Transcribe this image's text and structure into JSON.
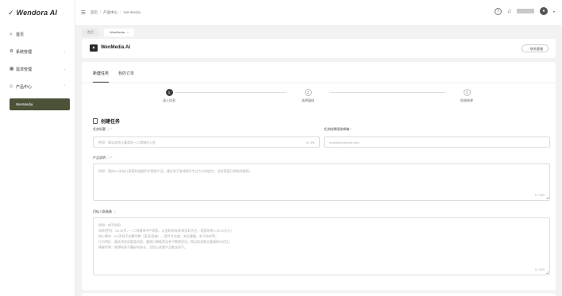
{
  "brand": {
    "name": "Wendora AI"
  },
  "sidebar": {
    "items": [
      {
        "label": "首页",
        "icon": "home-icon"
      },
      {
        "label": "系统管理",
        "icon": "gear-icon"
      },
      {
        "label": "需求管理",
        "icon": "grid-icon"
      },
      {
        "label": "产品中心",
        "icon": "tag-icon"
      }
    ],
    "active_sub": "WenMedia"
  },
  "header": {
    "breadcrumb": [
      "首页",
      "产品中心",
      "WenMedia"
    ]
  },
  "tabs": [
    {
      "label": "首页"
    },
    {
      "label": "WenMedia"
    }
  ],
  "app": {
    "title": "WenMedia AI",
    "contact_button": "联系客服"
  },
  "subtabs": [
    "新建任务",
    "我的订单"
  ],
  "steps": [
    {
      "number": "1",
      "label": "录入信息",
      "state": "done"
    },
    {
      "number": "2",
      "label": "选择媒体",
      "state": "todo"
    },
    {
      "number": "3",
      "label": "投放结果",
      "state": "todo"
    }
  ],
  "form": {
    "section_title": "创建任务",
    "task_title": {
      "label": "任务标题",
      "placeholder": "例如：青岛本地儿童游泳一二线城市入驻",
      "counter": "0 / 20"
    },
    "email": {
      "label": "任务结果接收邮箱",
      "placeholder": "email@example.com"
    },
    "product": {
      "label": "产品说明",
      "placeholder": "例如：面向3-6岁幼儿家庭的益智积木套装产品，通过亲子游戏提升专注力与创造力，适合家庭日常陪伴使用。",
      "counter": "0 / 300"
    },
    "audience": {
      "label": "目标人群画像",
      "placeholder_lines": [
        "例如：新手妈妈",
        "年龄/性别：28-35岁，一二线城市中产家庭，以全职妈妈/职场宝妈为主，家庭年收入20-40万元；",
        "核心需求：3-6岁孩子启蒙早教（英语/思维），提升专注度，安全健康，亲子陪伴等；",
        "行为特征：喜欢浏览母婴类内容，重视口碑推荐及亲子教育资讯，购买前会做大量调研与对比；",
        "情感共鸣：既想给孩子最好的成长，又担心选错产品耽误孩子。"
      ],
      "counter": "0 / 500"
    }
  }
}
